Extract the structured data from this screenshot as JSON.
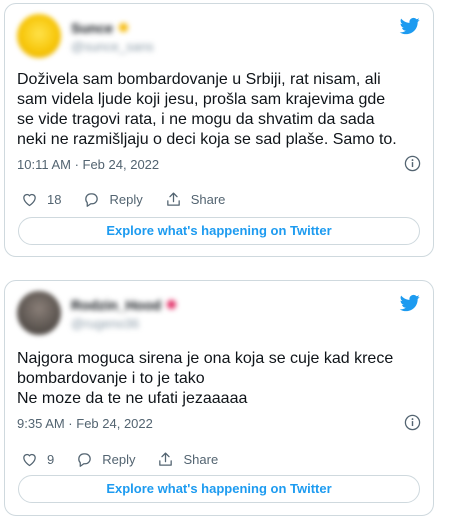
{
  "tweets": [
    {
      "author_name": "Sunce",
      "author_handle": "@sunce_sans",
      "text": "Doživela sam bombardovanje u Srbiji, rat nisam, ali\nsam videla ljude koji jesu, prošla sam krajevima gde\nse vide tragovi rata, i ne mogu da shvatim da sada\nneki ne razmišljaju o deci koja se sad plaše. Samo to.",
      "timestamp": "10:11 AM · Feb 24, 2022",
      "like_count": "18",
      "reply_label": "Reply",
      "share_label": "Share",
      "explore_label": "Explore what's happening on Twitter"
    },
    {
      "author_name": "Rodzin_Hood",
      "author_handle": "@rugeno36",
      "text": "Najgora moguca sirena je ona koja se cuje kad krece\nbombardovanje i to je tako\nNe moze da te ne ufati jezaaaaa",
      "timestamp": "9:35 AM · Feb 24, 2022",
      "like_count": "9",
      "reply_label": "Reply",
      "share_label": "Share",
      "explore_label": "Explore what's happening on Twitter"
    }
  ],
  "colors": {
    "twitter_blue": "#1d9bf0",
    "secondary_text": "#536471",
    "border": "#cfd9de"
  },
  "icons": [
    "twitter-bird-icon",
    "info-icon",
    "heart-icon",
    "reply-icon",
    "share-icon"
  ]
}
